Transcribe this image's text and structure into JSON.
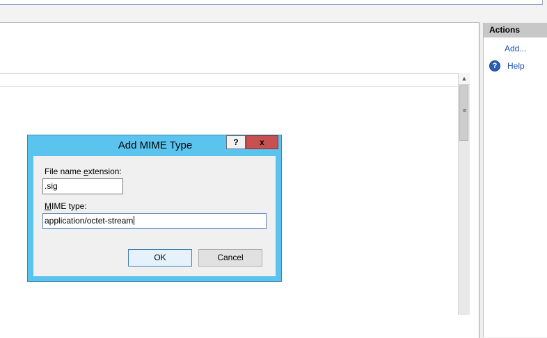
{
  "actions": {
    "title": "Actions",
    "add_label": "Add...",
    "help_label": "Help"
  },
  "dialog": {
    "title": "Add MIME Type",
    "help_button": "?",
    "close_button": "x",
    "extension": {
      "label_pre": "File name ",
      "label_underlined": "e",
      "label_post": "xtension:",
      "value": ".sig"
    },
    "mime": {
      "label_underlined": "M",
      "label_post": "IME type:",
      "value": "application/octet-stream"
    },
    "ok_label": "OK",
    "cancel_label": "Cancel"
  },
  "scrollbar": {
    "up_arrow": "▲",
    "grip": "≡"
  }
}
